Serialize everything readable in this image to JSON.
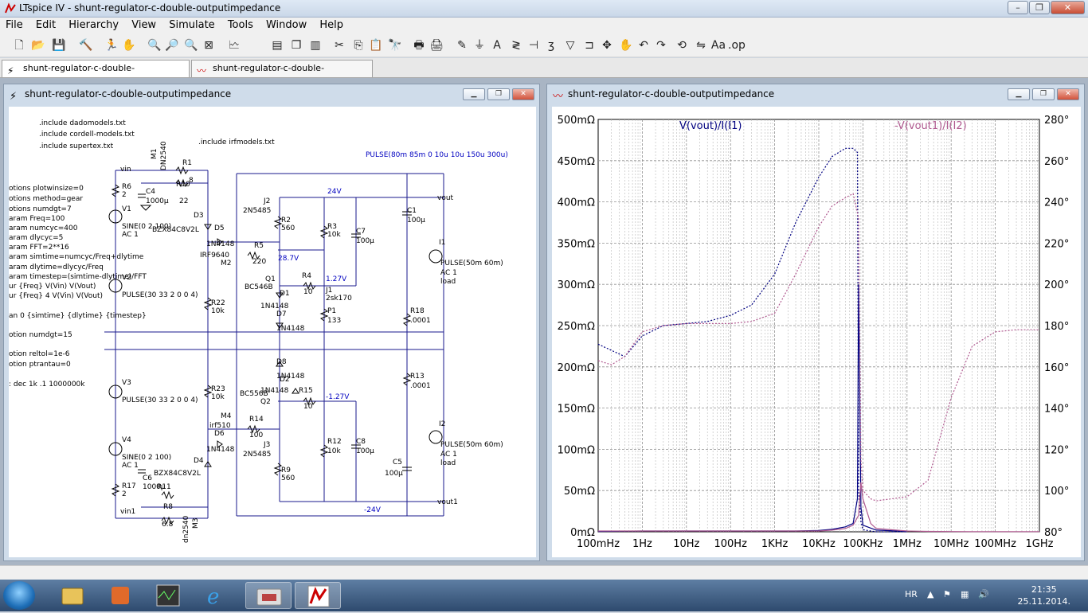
{
  "window": {
    "title": "LTspice IV - shunt-regulator-c-double-outputimpedance",
    "min": "–",
    "max": "❐",
    "close": "✕"
  },
  "menu": [
    "File",
    "Edit",
    "Hierarchy",
    "View",
    "Simulate",
    "Tools",
    "Window",
    "Help"
  ],
  "tabs": [
    {
      "label": "shunt-regulator-c-double-outputimpedance",
      "icon": "schematic-icon"
    },
    {
      "label": "shunt-regulator-c-double-outputimpedance",
      "icon": "waveform-icon"
    }
  ],
  "schematic": {
    "title": "shunt-regulator-c-double-outputimpedance",
    "texts": {
      "inc1": ".include dadomodels.txt",
      "inc2": ".include cordell-models.txt",
      "inc3": ".include supertex.txt",
      "inc4": ".include irfmodels.txt",
      "opt1": "otions plotwinsize=0",
      "opt2": "otions method=gear",
      "opt3": "otions numdgt=7",
      "par1": "aram Freq=100",
      "par2": "aram numcyc=400",
      "par3": "aram dlycyc=5",
      "par4": "aram FFT=2**16",
      "par5": "aram simtime=numcyc/Freq+dlytime",
      "par6": "aram dlytime=dlycyc/Freq",
      "par7": "aram timestep=(simtime-dlytime)/FFT",
      "fou1": "ur {Freq} V(Vin) V(Vout)",
      "fou2": "ur {Freq} 4 V(Vin) V(Vout)",
      "tran": "an 0 {simtime} {dlytime} {timestep}",
      "opt4": "otion numdgt=15",
      "opt5": "otion reltol=1e-6",
      "opt6": "otion ptrantau=0",
      "ac": ": dec 1k .1 1000000k",
      "pulse_top": "PULSE(80m 85m 0 10u 10u 150u 300u)",
      "vin": "vin",
      "vin1": "vin1",
      "vout": "vout",
      "vout1": "vout1",
      "v24": "24V",
      "vm24": "-24V",
      "v287": "28.7V",
      "v127": "1.27V",
      "vm127": "-1.27V",
      "R6": "R6",
      "R6v": "2",
      "C4": "C4",
      "C4v": "1000µ",
      "M1": "M1",
      "M1v": "DN2540",
      "R1": "R1",
      "R1v": "8",
      "R10": "R10",
      "R10v": "22",
      "V1": "V1",
      "V1a": "SINE(0 2 100)",
      "V1b": "AC 1",
      "D3": "D3",
      "D3v": "BZX84C8V2L",
      "D5": "D5",
      "D5v": "1N4148",
      "M2v": "IRF9640",
      "M2": "M2",
      "R5": "R5",
      "R5v": "220",
      "V2": "V2",
      "V2a": "PULSE(30 33 2 0 0 4)",
      "R22": "R22",
      "R22v": "10k",
      "J2": "J2",
      "J2v": "2N5485",
      "R2": "R2",
      "R2v": "560",
      "R3": "R3",
      "R3v": "10k",
      "C7": "C7",
      "C7v": "100µ",
      "C1": "C1",
      "C1v": "100µ",
      "I1": "I1",
      "I1a": "PULSE(50m 60m)",
      "I1b": "AC 1",
      "I1c": "load",
      "Q1": "Q1",
      "Q1v": "BC546B",
      "R4": "R4",
      "R4v": "10",
      "D1": "D1",
      "D1v": "1N4148",
      "J1": "J1",
      "J1v": "2sk170",
      "D7": "D7",
      "D7v": "1N4148",
      "P1": "P1",
      "P1v": "133",
      "R18": "R18",
      "R18v": ".0001",
      "V3": "V3",
      "V3a": "PULSE(30 33 2 0 0 4)",
      "R23": "R23",
      "R23v": "10k",
      "D8": "D8",
      "D8v": "1N4148",
      "D2": "D2",
      "D2v": "1N4148",
      "Q2v": "BC556B",
      "Q2": "Q2",
      "R15": "R15",
      "R15v": "10",
      "R13": "R13",
      "R13v": ".0001",
      "M4": "M4",
      "M4v": "irf510",
      "R14": "R14",
      "R14v": "100",
      "D6": "D6",
      "D6v": "1N4148",
      "J3": "J3",
      "J3v": "2N5485",
      "R12": "R12",
      "R12v": "10k",
      "C8": "C8",
      "C8v": "100µ",
      "I2": "I2",
      "I2a": "PULSE(50m 60m)",
      "I2b": "AC 1",
      "I2c": "load",
      "V4": "V4",
      "V4a": "SINE(0 2 100)",
      "V4b": "AC 1",
      "D4": "D4",
      "D4v": "BZX84C8V2L",
      "C6": "C6",
      "C6v": "1000µ",
      "R11": "R11",
      "R17": "R17",
      "R17v": "2",
      "R8": "R8",
      "R8v": "6.8",
      "M3": "M3",
      "M3v": "dn2540",
      "R9": "R9",
      "R9v": "560",
      "C5": "C5",
      "C5v": "100µ"
    }
  },
  "plot_window": {
    "title": "shunt-regulator-c-double-outputimpedance"
  },
  "chart_data": {
    "type": "line",
    "title": "",
    "xscale": "log",
    "xlim": [
      0.1,
      1000000000
    ],
    "ylim": [
      0,
      500
    ],
    "y2lim": [
      80,
      280
    ],
    "x_ticks": [
      "100mHz",
      "1Hz",
      "10Hz",
      "100Hz",
      "1KHz",
      "10KHz",
      "100KHz",
      "1MHz",
      "10MHz",
      "100MHz",
      "1GHz"
    ],
    "y_ticks": [
      "0mΩ",
      "50mΩ",
      "100mΩ",
      "150mΩ",
      "200mΩ",
      "250mΩ",
      "300mΩ",
      "350mΩ",
      "400mΩ",
      "450mΩ",
      "500mΩ"
    ],
    "y2_ticks": [
      "80°",
      "100°",
      "120°",
      "140°",
      "160°",
      "180°",
      "200°",
      "220°",
      "240°",
      "260°",
      "280°"
    ],
    "grid": true,
    "series": [
      {
        "name": "V(vout)/I(I1)",
        "color": "#000080",
        "x": [
          0.1,
          0.2,
          0.4,
          1,
          3,
          10,
          30,
          100,
          300,
          1000,
          3000,
          10000,
          20000,
          40000,
          60000,
          75000,
          80000,
          90000,
          100000,
          200000,
          1000000
        ],
        "mag": [
          0.4,
          0.6,
          0.8,
          1,
          1,
          1,
          1,
          1,
          1,
          1,
          1,
          1.5,
          3,
          6,
          10,
          40,
          300,
          30,
          8,
          2,
          0.5
        ],
        "phase": [
          171,
          168,
          165,
          175,
          180,
          181,
          182,
          185,
          190,
          205,
          230,
          252,
          262,
          266,
          266,
          264,
          100,
          85,
          81,
          80,
          80
        ]
      },
      {
        "name": "-V(vout1)/I(I2)",
        "color": "#b05a90",
        "x": [
          0.1,
          0.2,
          0.4,
          1,
          3,
          10,
          30,
          100,
          300,
          1000,
          3000,
          10000,
          20000,
          40000,
          60000,
          80000,
          90000,
          100000,
          150000,
          200000,
          1000000,
          3000000,
          10000000,
          30000000,
          100000000,
          300000000,
          1000000000
        ],
        "mag": [
          1,
          1,
          1,
          1,
          1,
          1,
          1,
          1,
          1,
          1,
          1,
          1,
          2,
          4,
          8,
          20,
          60,
          40,
          10,
          4,
          1,
          0.5,
          0.3,
          0.2,
          0.2,
          0.2,
          0.2
        ],
        "phase": [
          163,
          161,
          165,
          177,
          180,
          181,
          181,
          181,
          182,
          186,
          205,
          228,
          238,
          242,
          244,
          232,
          115,
          100,
          96,
          95,
          97,
          105,
          145,
          170,
          177,
          178,
          178
        ]
      }
    ]
  },
  "taskbar": {
    "lang": "HR",
    "time": "21:35",
    "date": "25.11.2014."
  }
}
